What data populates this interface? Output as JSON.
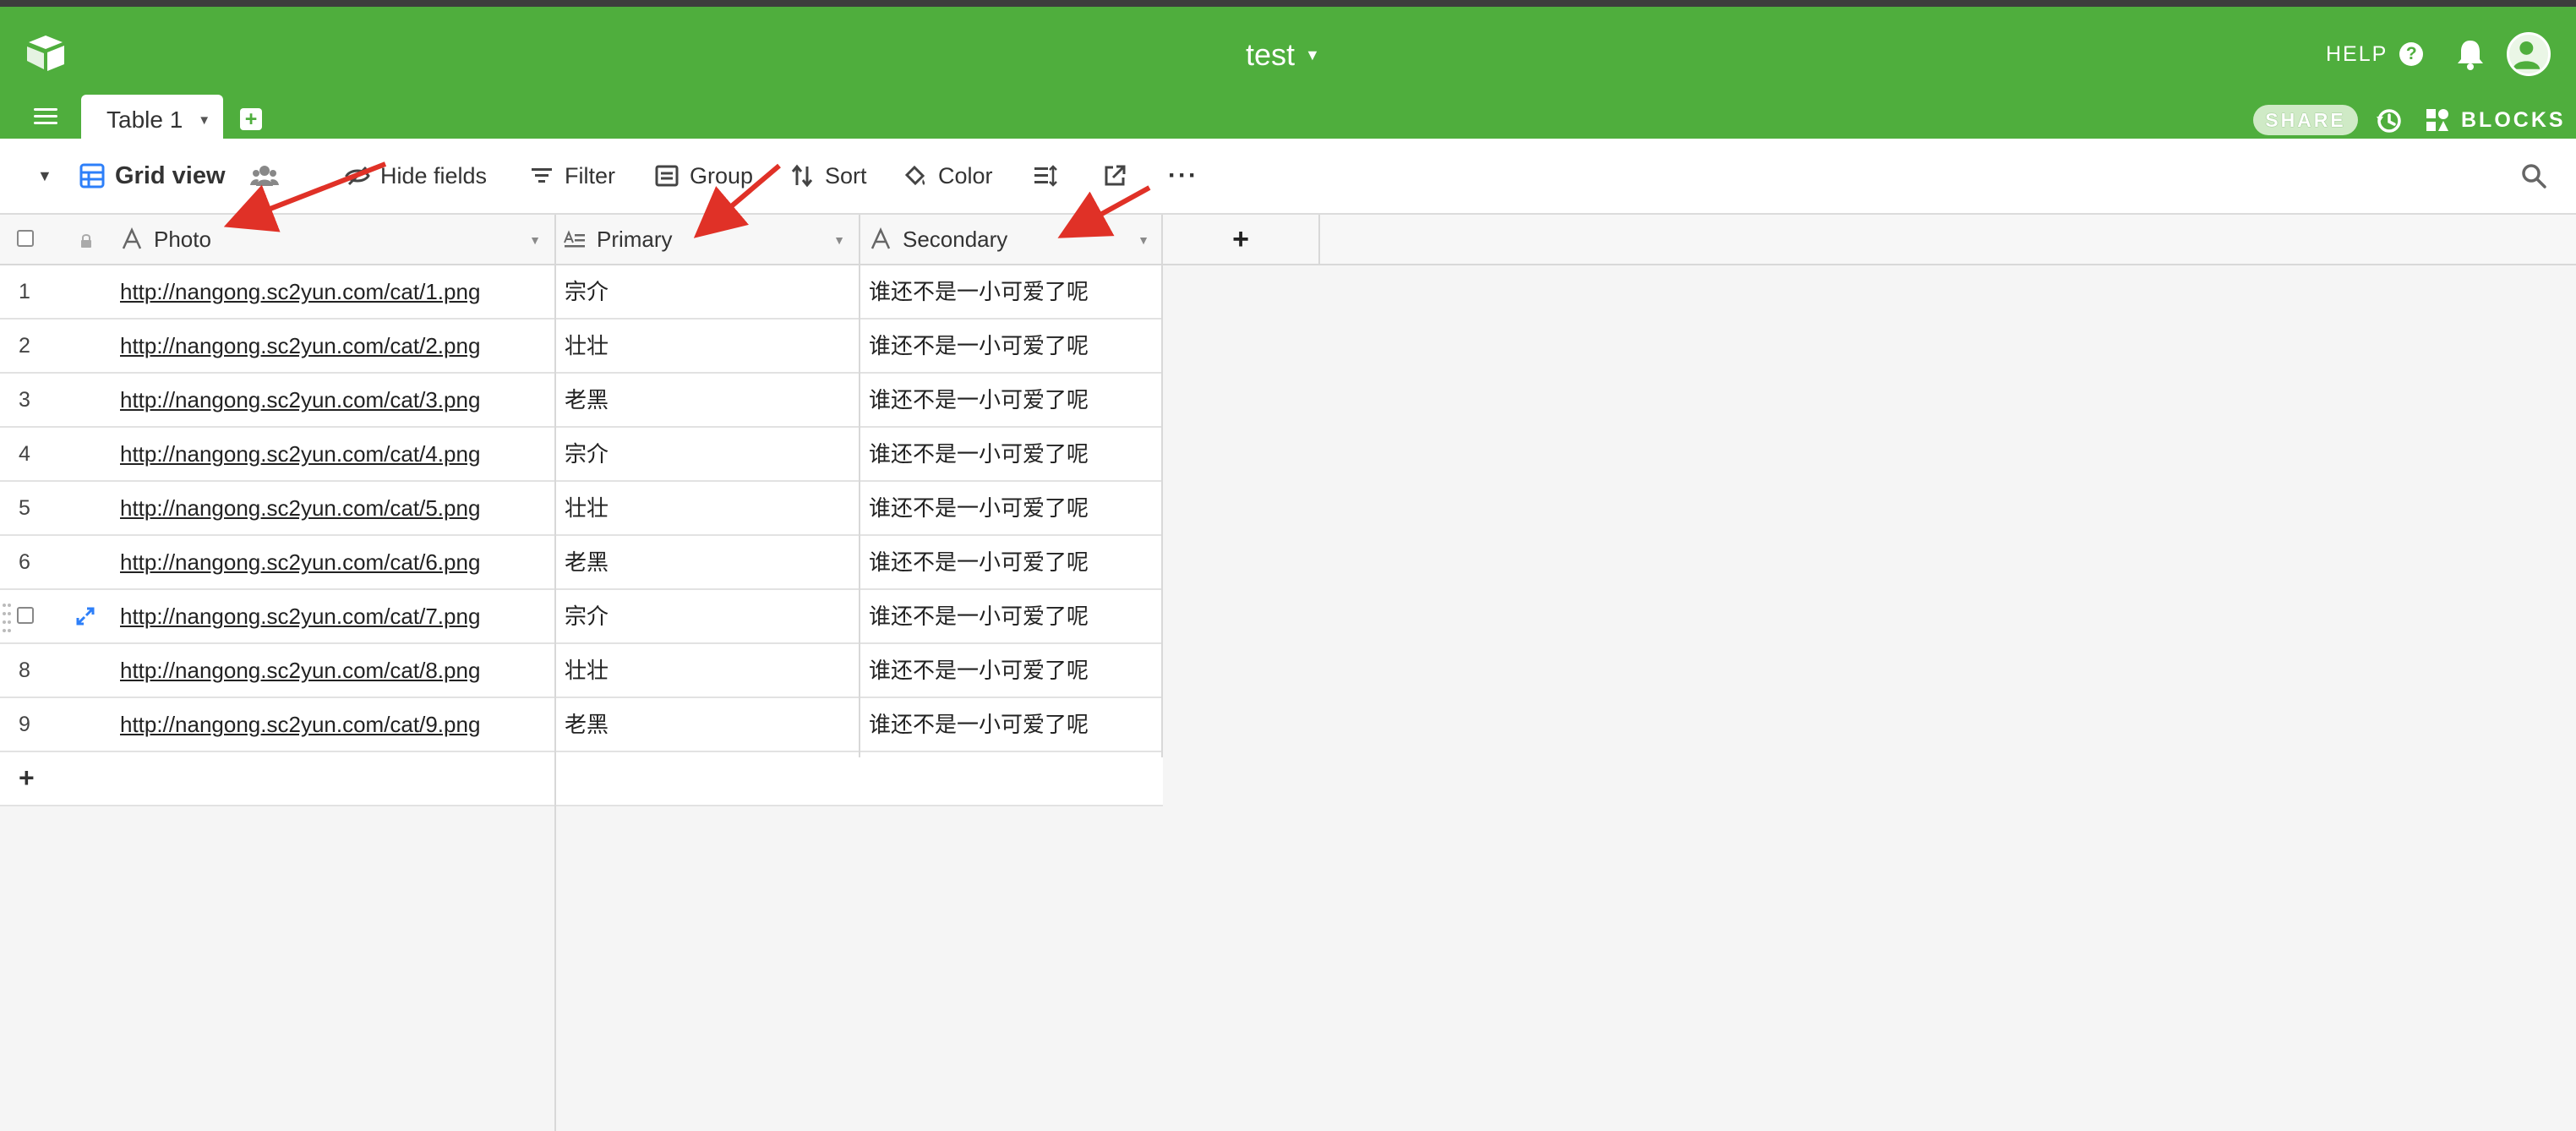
{
  "app": {
    "base_name": "test",
    "help_label": "HELP",
    "share_label": "SHARE",
    "blocks_label": "BLOCKS",
    "accent_color": "#4fae3d"
  },
  "tabs": [
    {
      "label": "Table 1",
      "active": true
    }
  ],
  "viewbar": {
    "view_name": "Grid view",
    "hide_fields": "Hide fields",
    "filter": "Filter",
    "group": "Group",
    "sort": "Sort",
    "color": "Color"
  },
  "columns": [
    {
      "name": "Photo",
      "icon": "text-icon"
    },
    {
      "name": "Primary",
      "icon": "long-text-icon"
    },
    {
      "name": "Secondary",
      "icon": "text-icon"
    }
  ],
  "rows": [
    {
      "id": "1",
      "photo": "http://nangong.sc2yun.com/cat/1.png",
      "primary": "宗介",
      "secondary": "谁还不是一小可爱了呢"
    },
    {
      "id": "2",
      "photo": "http://nangong.sc2yun.com/cat/2.png",
      "primary": "壮壮",
      "secondary": "谁还不是一小可爱了呢"
    },
    {
      "id": "3",
      "photo": "http://nangong.sc2yun.com/cat/3.png",
      "primary": "老黑",
      "secondary": "谁还不是一小可爱了呢"
    },
    {
      "id": "4",
      "photo": "http://nangong.sc2yun.com/cat/4.png",
      "primary": "宗介",
      "secondary": "谁还不是一小可爱了呢"
    },
    {
      "id": "5",
      "photo": "http://nangong.sc2yun.com/cat/5.png",
      "primary": "壮壮",
      "secondary": "谁还不是一小可爱了呢"
    },
    {
      "id": "6",
      "photo": "http://nangong.sc2yun.com/cat/6.png",
      "primary": "老黑",
      "secondary": "谁还不是一小可爱了呢"
    },
    {
      "id": "7",
      "photo": "http://nangong.sc2yun.com/cat/7.png",
      "primary": "宗介",
      "secondary": "谁还不是一小可爱了呢",
      "hovered": true
    },
    {
      "id": "8",
      "photo": "http://nangong.sc2yun.com/cat/8.png",
      "primary": "壮壮",
      "secondary": "谁还不是一小可爱了呢"
    },
    {
      "id": "9",
      "photo": "http://nangong.sc2yun.com/cat/9.png",
      "primary": "老黑",
      "secondary": "谁还不是一小可爱了呢"
    }
  ],
  "add_column_label": "+",
  "add_row_label": "+"
}
